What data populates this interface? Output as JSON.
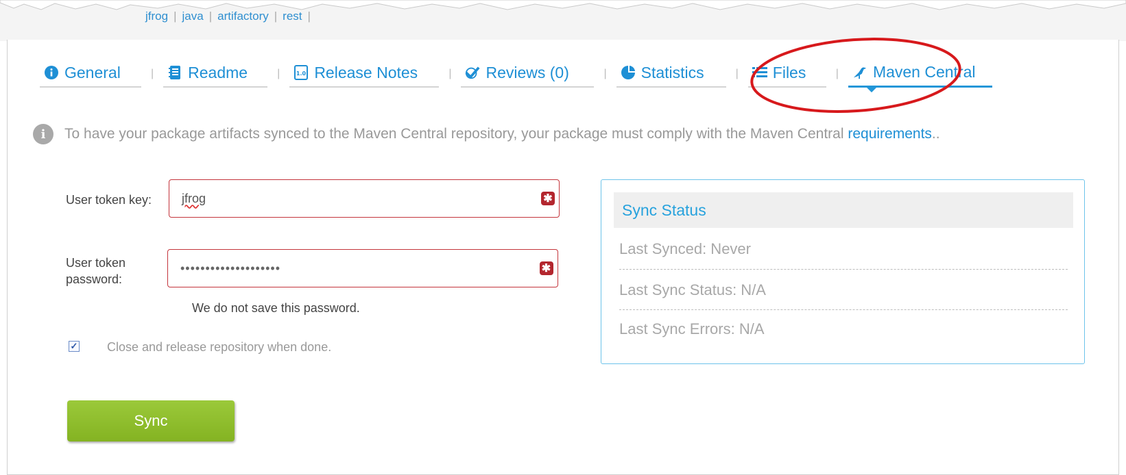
{
  "breadcrumb_tags": [
    "jfrog",
    "java",
    "artifactory",
    "rest"
  ],
  "tabs": [
    {
      "label": "General",
      "icon": "info-icon"
    },
    {
      "label": "Readme",
      "icon": "notebook-icon"
    },
    {
      "label": "Release Notes",
      "icon": "release-notes-icon"
    },
    {
      "label": "Reviews (0)",
      "icon": "checkmark-icon"
    },
    {
      "label": "Statistics",
      "icon": "pie-chart-icon"
    },
    {
      "label": "Files",
      "icon": "list-icon"
    },
    {
      "label": "Maven Central",
      "icon": "bird-icon",
      "active": true
    }
  ],
  "info": {
    "text": "To have your package artifacts synced to the Maven Central repository, your package must comply with the Maven Central",
    "link": "requirements",
    "suffix": ".."
  },
  "form": {
    "token_key_label": "User token key:",
    "token_key_value": "jfrog",
    "token_password_label_1": "User token",
    "token_password_label_2": "password:",
    "token_password_value": "••••••••••••••••••••",
    "password_hint": "We do not save this password.",
    "close_release_checked": true,
    "close_release_label": "Close and release repository when done.",
    "sync_button": "Sync"
  },
  "sync_status": {
    "title": "Sync Status",
    "last_synced": "Last Synced: Never",
    "last_sync_status": "Last Sync Status: N/A",
    "last_sync_errors": "Last Sync Errors: N/A"
  },
  "colors": {
    "accent": "#1e8fd5",
    "required_border": "#c4343b",
    "sync_button": "#8dbb2a",
    "annotation_circle": "#d7191c"
  }
}
